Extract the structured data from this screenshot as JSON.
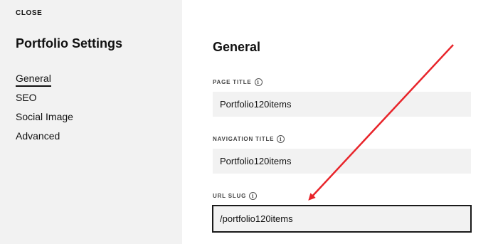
{
  "sidebar": {
    "close_label": "CLOSE",
    "title": "Portfolio Settings",
    "items": [
      {
        "label": "General",
        "active": true
      },
      {
        "label": "SEO",
        "active": false
      },
      {
        "label": "Social Image",
        "active": false
      },
      {
        "label": "Advanced",
        "active": false
      }
    ]
  },
  "main": {
    "section_title": "General",
    "fields": {
      "page_title": {
        "label": "PAGE TITLE",
        "value": "Portfolio120items"
      },
      "navigation_title": {
        "label": "NAVIGATION TITLE",
        "value": "Portfolio120items"
      },
      "url_slug": {
        "label": "URL SLUG",
        "value": "/portfolio120items"
      }
    },
    "info_glyph": "i"
  },
  "annotation": {
    "arrow_color": "#e8242a"
  }
}
